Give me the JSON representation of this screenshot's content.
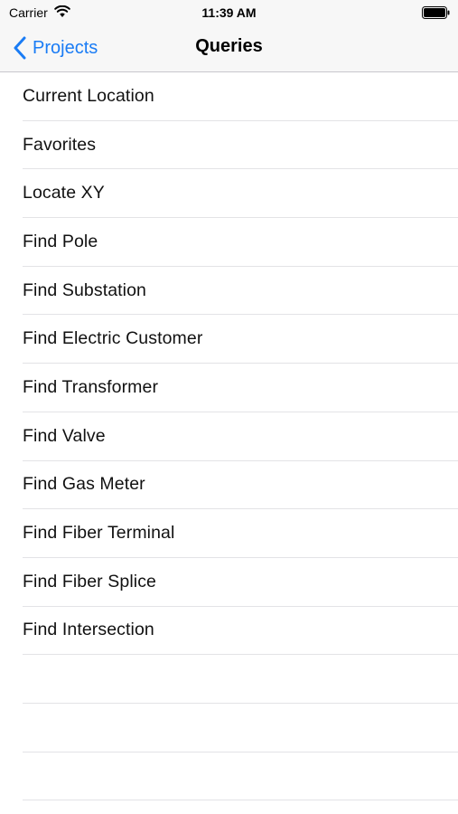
{
  "status_bar": {
    "carrier": "Carrier",
    "time": "11:39 AM",
    "wifi_icon": "wifi-icon",
    "battery_icon": "battery-full-icon"
  },
  "nav": {
    "back_label": "Projects",
    "back_icon": "chevron-left-icon",
    "title": "Queries",
    "accent_color": "#1a7cf5"
  },
  "queries": {
    "items": [
      "Current Location",
      "Favorites",
      "Locate XY",
      "Find Pole",
      "Find Substation",
      "Find Electric Customer",
      "Find Transformer",
      "Find Valve",
      "Find Gas Meter",
      "Find Fiber Terminal",
      "Find Fiber Splice",
      "Find Intersection"
    ]
  }
}
